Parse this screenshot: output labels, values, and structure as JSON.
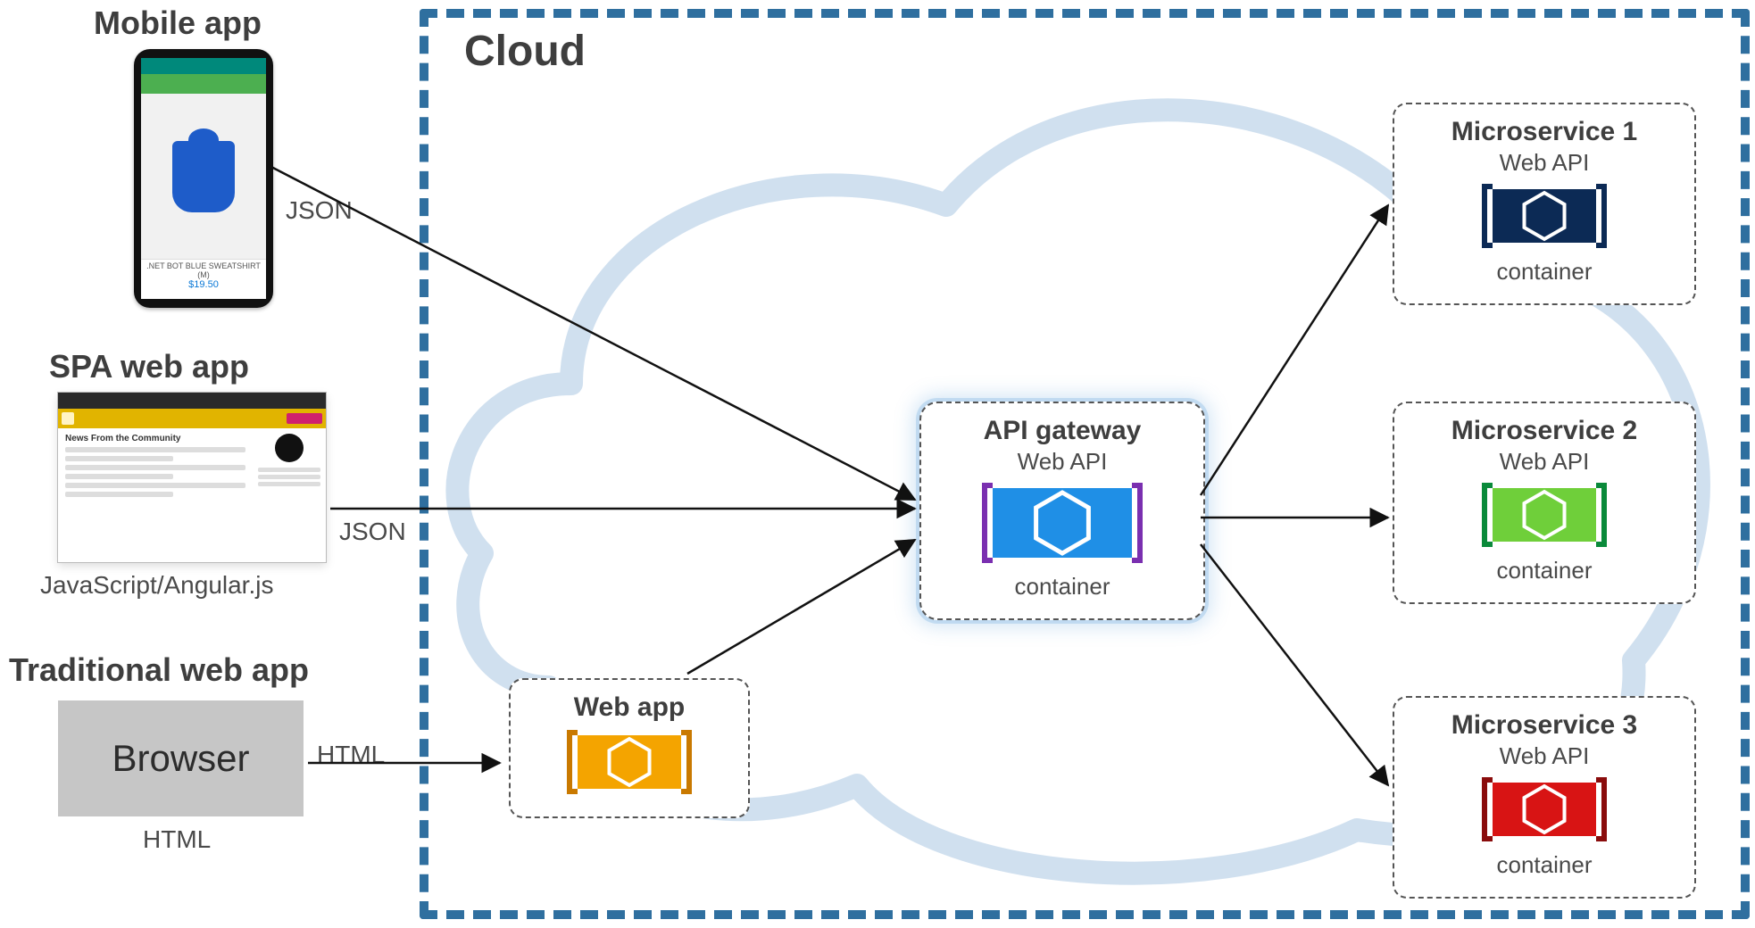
{
  "clients": {
    "mobile": {
      "heading": "Mobile app",
      "product_caption": ".NET BOT BLUE SWEATSHIRT (M)",
      "price": "$19.50",
      "protocol_label": "JSON"
    },
    "spa": {
      "heading": "SPA web app",
      "tech_label": "JavaScript/Angular.js",
      "protocol_label": "JSON",
      "news_heading": "News From the Community"
    },
    "traditional": {
      "heading": "Traditional web app",
      "block_label": "Browser",
      "tech_label": "HTML",
      "protocol_label": "HTML"
    }
  },
  "cloud": {
    "title": "Cloud",
    "webapp": {
      "title": "Web app"
    },
    "gateway": {
      "title": "API gateway",
      "api_label": "Web API",
      "container_label": "container"
    },
    "ms1": {
      "title": "Microservice 1",
      "api_label": "Web API",
      "container_label": "container"
    },
    "ms2": {
      "title": "Microservice 2",
      "api_label": "Web API",
      "container_label": "container"
    },
    "ms3": {
      "title": "Microservice 3",
      "api_label": "Web API",
      "container_label": "container"
    }
  },
  "icons": {
    "webapp": {
      "fill": "#f4a400",
      "stroke": "#c97900",
      "hex_stroke": "#ffffff"
    },
    "gateway": {
      "fill": "#1f8fe6",
      "stroke": "#7a2fb0",
      "hex_stroke": "#ffffff"
    },
    "ms1": {
      "fill": "#0c2a55",
      "stroke": "#0c2a55",
      "hex_stroke": "#ffffff"
    },
    "ms2": {
      "fill": "#6fcf3a",
      "stroke": "#0a8a3a",
      "hex_stroke": "#ffffff"
    },
    "ms3": {
      "fill": "#d81414",
      "stroke": "#8a0c0c",
      "hex_stroke": "#ffffff"
    }
  },
  "diagram": {
    "arrows": [
      {
        "name": "arrow-mobile-to-gateway",
        "from": "mobile-app",
        "to": "api-gateway"
      },
      {
        "name": "arrow-spa-to-gateway",
        "from": "spa-web-app",
        "to": "api-gateway"
      },
      {
        "name": "arrow-browser-to-webapp",
        "from": "browser",
        "to": "web-app"
      },
      {
        "name": "arrow-webapp-to-gateway",
        "from": "web-app",
        "to": "api-gateway"
      },
      {
        "name": "arrow-gateway-to-ms1",
        "from": "api-gateway",
        "to": "microservice-1"
      },
      {
        "name": "arrow-gateway-to-ms2",
        "from": "api-gateway",
        "to": "microservice-2"
      },
      {
        "name": "arrow-gateway-to-ms3",
        "from": "api-gateway",
        "to": "microservice-3"
      }
    ]
  }
}
